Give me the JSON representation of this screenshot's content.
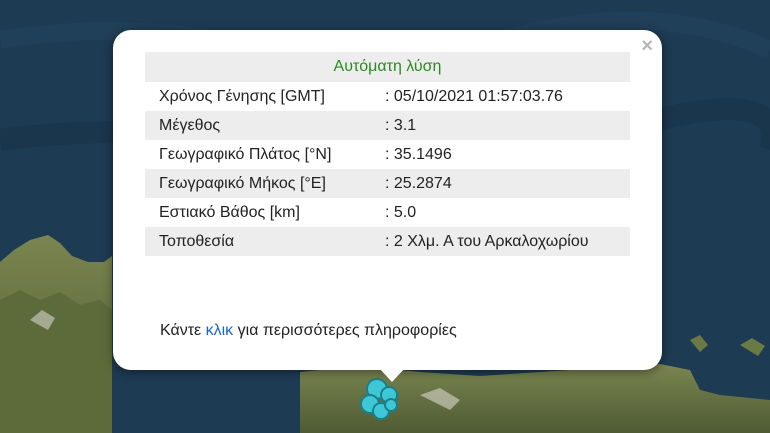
{
  "popup": {
    "title": "Αυτόματη λύση",
    "close_symbol": "×",
    "rows": [
      {
        "label": "Χρόνος Γένησης [GMT]",
        "value": ": 05/10/2021 01:57:03.76"
      },
      {
        "label": "Μέγεθος",
        "value": ": 3.1"
      },
      {
        "label": "Γεωγραφικό Πλάτος [°N]",
        "value": ": 35.1496"
      },
      {
        "label": "Γεωγραφικό Μήκος [°E]",
        "value": ": 25.2874"
      },
      {
        "label": "Εστιακό Βάθος [km]",
        "value": ": 5.0"
      },
      {
        "label": "Τοποθεσία",
        "value": ": 2 Χλμ. Α του Αρκαλοχωρίου"
      }
    ],
    "footer_prefix": "Κάντε ",
    "footer_link": "κλικ",
    "footer_suffix": " για περισσότερες πληροφορίες"
  },
  "colors": {
    "sea": "#1d3b53",
    "land": "#6b7a45",
    "title_green": "#2b8a1e",
    "link_blue": "#1a66c9",
    "marker": "#3ec8d6"
  },
  "icons": {
    "close": "close-icon",
    "marker": "earthquake-marker-icon"
  }
}
